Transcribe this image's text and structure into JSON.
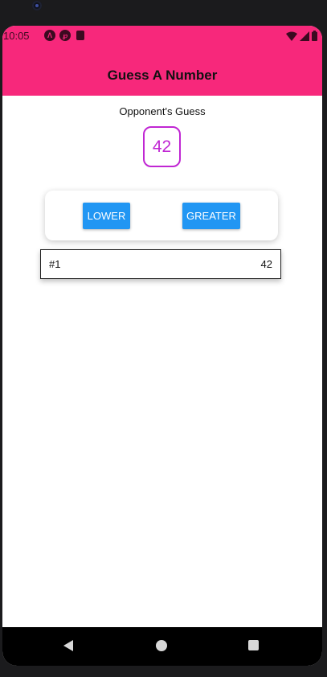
{
  "status_bar": {
    "time": "10:05"
  },
  "header": {
    "title": "Guess A Number"
  },
  "game": {
    "opponent_label": "Opponent's Guess",
    "current_guess": "42"
  },
  "controls": {
    "lower_label": "LOWER",
    "greater_label": "GREATER"
  },
  "log": {
    "rounds": [
      {
        "round": "#1",
        "value": "42"
      }
    ]
  },
  "theme": {
    "header_color": "#f7287b",
    "accent_color": "#c026d3",
    "button_color": "#2196f3"
  },
  "icons": {
    "status_left": [
      "react-native-icon",
      "expo-icon",
      "sd-card-icon"
    ],
    "status_right": [
      "wifi-icon",
      "cell-signal-icon",
      "battery-icon"
    ],
    "nav": [
      "back-icon",
      "home-icon",
      "recent-apps-icon"
    ]
  }
}
